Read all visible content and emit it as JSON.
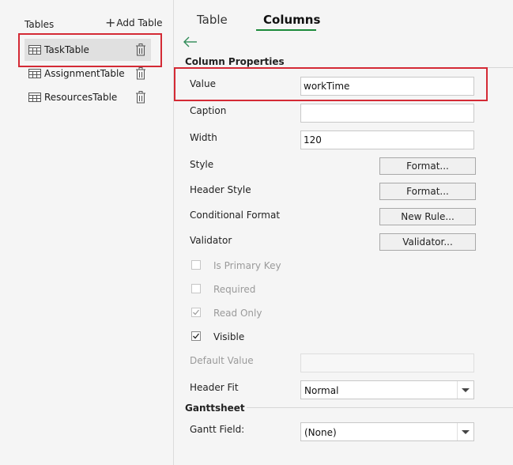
{
  "sidebar": {
    "header": "Tables",
    "add_table_label": "Add Table",
    "items": [
      {
        "label": "TaskTable",
        "selected": true
      },
      {
        "label": "AssignmentTable",
        "selected": false
      },
      {
        "label": "ResourcesTable",
        "selected": false
      }
    ]
  },
  "tabs": [
    {
      "label": "Table",
      "active": false
    },
    {
      "label": "Columns",
      "active": true
    }
  ],
  "column_properties": {
    "title": "Column Properties",
    "value_label": "Value",
    "value": "workTime",
    "caption_label": "Caption",
    "caption": "",
    "width_label": "Width",
    "width": "120",
    "style_label": "Style",
    "style_button": "Format...",
    "header_style_label": "Header Style",
    "header_style_button": "Format...",
    "conditional_format_label": "Conditional Format",
    "conditional_format_button": "New Rule...",
    "validator_label": "Validator",
    "validator_button": "Validator...",
    "checkboxes": [
      {
        "label": "Is Primary Key",
        "checked": false,
        "enabled": false
      },
      {
        "label": "Required",
        "checked": false,
        "enabled": false
      },
      {
        "label": "Read Only",
        "checked": true,
        "enabled": false
      },
      {
        "label": "Visible",
        "checked": true,
        "enabled": true
      }
    ],
    "default_value_label": "Default Value",
    "default_value": "",
    "header_fit_label": "Header Fit",
    "header_fit": "Normal"
  },
  "ganttsheet": {
    "title": "Ganttsheet",
    "gantt_field_label": "Gantt Field:",
    "gantt_field": "(None)"
  },
  "colors": {
    "highlight_border": "#d42a35",
    "active_tab_underline": "#1b8a3a",
    "back_arrow": "#2e8b57"
  },
  "icons": {
    "table": "table-grid-icon",
    "delete": "trash-icon",
    "back": "back-arrow-icon",
    "dropdown": "chevron-down-icon",
    "check": "checkmark-icon"
  }
}
